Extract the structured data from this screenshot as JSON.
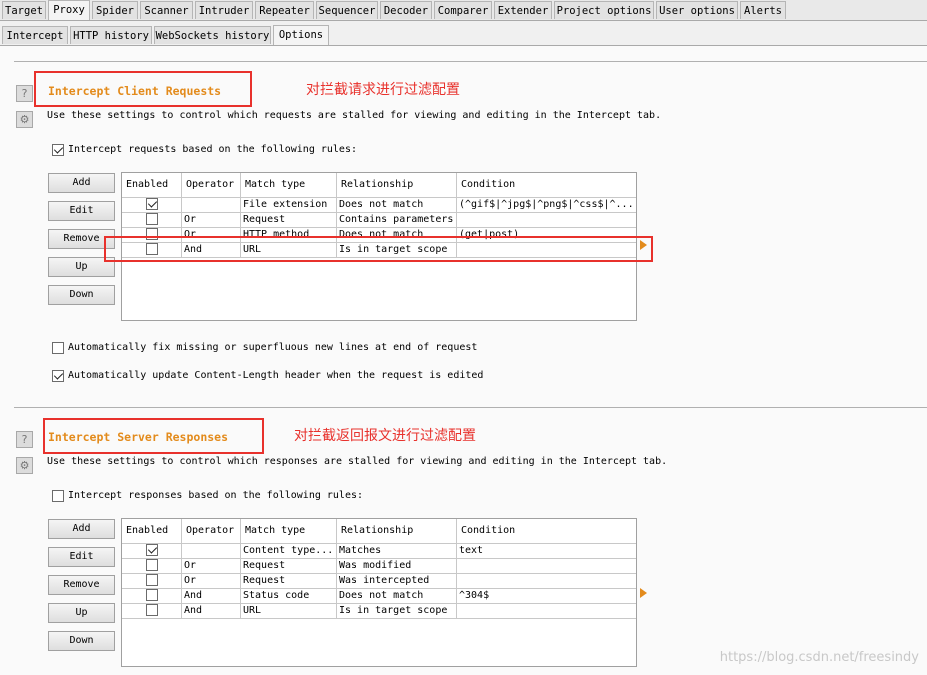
{
  "main_tabs": [
    "Target",
    "Proxy",
    "Spider",
    "Scanner",
    "Intruder",
    "Repeater",
    "Sequencer",
    "Decoder",
    "Comparer",
    "Extender",
    "Project options",
    "User options",
    "Alerts"
  ],
  "sub_tabs": [
    "Intercept",
    "HTTP history",
    "WebSockets history",
    "Options"
  ],
  "client": {
    "title": "Intercept Client Requests",
    "annotation": "对拦截请求进行过滤配置",
    "description": "Use these settings to control which requests are stalled for viewing and editing in the Intercept tab.",
    "rule_checkbox_label": "Intercept requests based on the following rules:",
    "rule_checkbox_checked": true,
    "buttons": [
      "Add",
      "Edit",
      "Remove",
      "Up",
      "Down"
    ],
    "columns": [
      "Enabled",
      "Operator",
      "Match type",
      "Relationship",
      "Condition"
    ],
    "rows": [
      {
        "enabled": true,
        "operator": "",
        "match_type": "File extension",
        "relationship": "Does not match",
        "condition": "(^gif$|^jpg$|^png$|^css$|^..."
      },
      {
        "enabled": false,
        "operator": "Or",
        "match_type": "Request",
        "relationship": "Contains parameters",
        "condition": ""
      },
      {
        "enabled": false,
        "operator": "Or",
        "match_type": "HTTP method",
        "relationship": "Does not match",
        "condition": "(get|post)"
      },
      {
        "enabled": false,
        "operator": "And",
        "match_type": "URL",
        "relationship": "Is in target scope",
        "condition": ""
      }
    ],
    "opt_fix_newlines": {
      "label": "Automatically fix missing or superfluous new lines at end of request",
      "checked": false
    },
    "opt_content_length": {
      "label": "Automatically update Content-Length header when the request is edited",
      "checked": true
    }
  },
  "server": {
    "title": "Intercept Server Responses",
    "annotation": "对拦截返回报文进行过滤配置",
    "description": "Use these settings to control which responses are stalled for viewing and editing in the Intercept tab.",
    "rule_checkbox_label": "Intercept responses based on the following rules:",
    "rule_checkbox_checked": false,
    "buttons": [
      "Add",
      "Edit",
      "Remove",
      "Up",
      "Down"
    ],
    "columns": [
      "Enabled",
      "Operator",
      "Match type",
      "Relationship",
      "Condition"
    ],
    "rows": [
      {
        "enabled": true,
        "operator": "",
        "match_type": "Content type...",
        "relationship": "Matches",
        "condition": "text"
      },
      {
        "enabled": false,
        "operator": "Or",
        "match_type": "Request",
        "relationship": "Was modified",
        "condition": ""
      },
      {
        "enabled": false,
        "operator": "Or",
        "match_type": "Request",
        "relationship": "Was intercepted",
        "condition": ""
      },
      {
        "enabled": false,
        "operator": "And",
        "match_type": "Status code",
        "relationship": "Does not match",
        "condition": "^304$"
      },
      {
        "enabled": false,
        "operator": "And",
        "match_type": "URL",
        "relationship": "Is in target scope",
        "condition": ""
      }
    ]
  },
  "watermark": "https://blog.csdn.net/freesindy",
  "colors": {
    "accent": "#e38b1c",
    "annotation_red": "#e8312c"
  },
  "icons": {
    "help": "help-icon",
    "settings": "gear-icon"
  }
}
